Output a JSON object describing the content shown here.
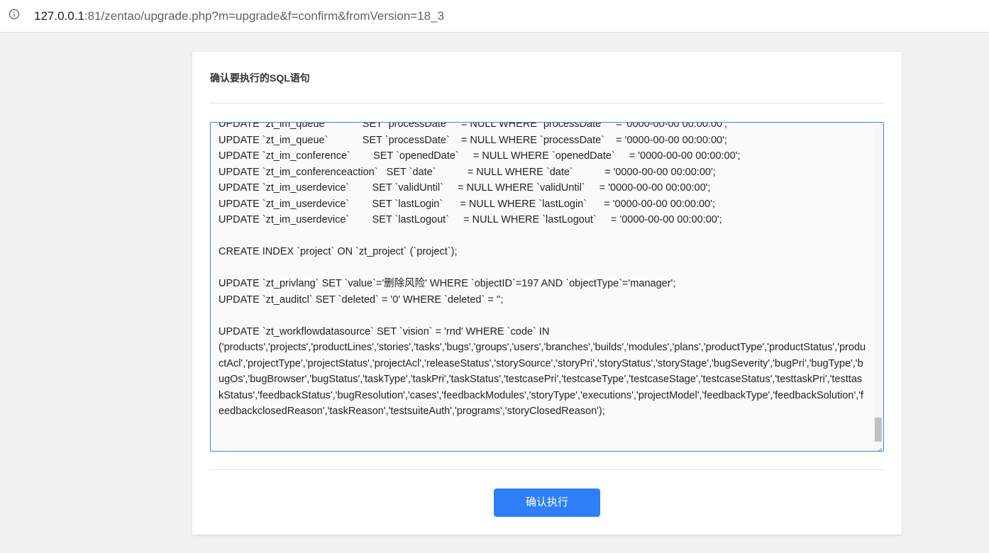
{
  "browser": {
    "url_host": "127.0.0.1",
    "url_rest": ":81/zentao/upgrade.php?m=upgrade&f=confirm&fromVersion=18_3",
    "info_icon": "info-icon"
  },
  "panel": {
    "title": "确认要执行的SQL语句",
    "sql_text": "UPDATE `zt_im_queue`            SET `processDate`    = NULL WHERE `processDate`    = '0000-00-00 00:00:00';\nUPDATE `zt_im_queue`            SET `processDate`    = NULL WHERE `processDate`    = '0000-00-00 00:00:00';\nUPDATE `zt_im_conference`        SET `openedDate`     = NULL WHERE `openedDate`     = '0000-00-00 00:00:00';\nUPDATE `zt_im_conferenceaction`   SET `date`           = NULL WHERE `date`           = '0000-00-00 00:00:00';\nUPDATE `zt_im_userdevice`        SET `validUntil`     = NULL WHERE `validUntil`     = '0000-00-00 00:00:00';\nUPDATE `zt_im_userdevice`        SET `lastLogin`      = NULL WHERE `lastLogin`      = '0000-00-00 00:00:00';\nUPDATE `zt_im_userdevice`        SET `lastLogout`     = NULL WHERE `lastLogout`     = '0000-00-00 00:00:00';\n\nCREATE INDEX `project` ON `zt_project` (`project`);\n\nUPDATE `zt_privlang` SET `value`='删除风险' WHERE `objectID`=197 AND `objectType`='manager';\nUPDATE `zt_auditcl` SET `deleted` = '0' WHERE `deleted` = '';\n\nUPDATE `zt_workflowdatasource` SET `vision` = 'rnd' WHERE `code` IN\n('products','projects','productLines','stories','tasks','bugs','groups','users','branches','builds','modules','plans','productType','productStatus','productAcl','projectType','projectStatus','projectAcl','releaseStatus','storySource','storyPri','storyStatus','storyStage','bugSeverity','bugPri','bugType','bugOs','bugBrowser','bugStatus','taskType','taskPri','taskStatus','testcasePri','testcaseType','testcaseStage','testcaseStatus','testtaskPri','testtaskStatus','feedbackStatus','bugResolution','cases','feedbackModules','storyType','executions','projectModel','feedbackType','feedbackSolution','feedbackclosedReason','taskReason','testsuiteAuth','programs','storyClosedReason');\n",
    "confirm_label": "确认执行"
  },
  "colors": {
    "accent": "#2e7ff8",
    "focus_border": "#3a86f2",
    "page_bg": "#f1f1f1"
  }
}
